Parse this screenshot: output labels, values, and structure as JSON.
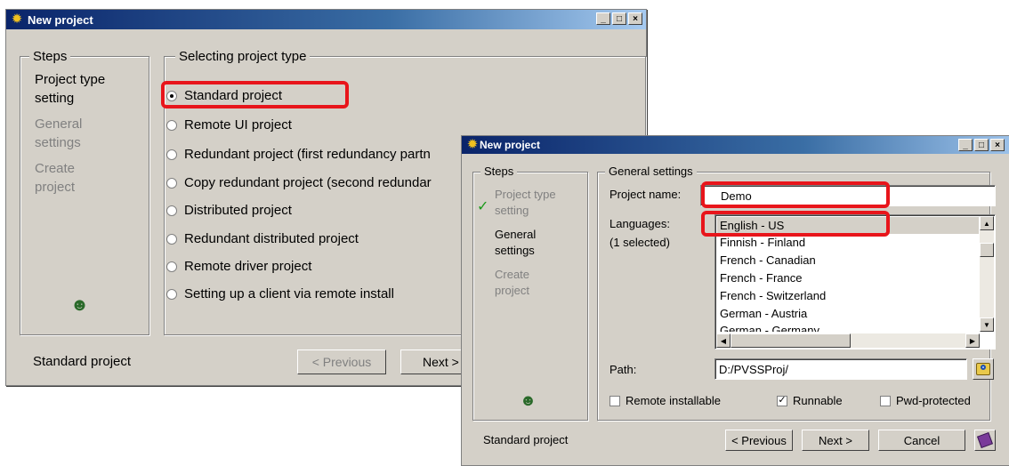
{
  "window1": {
    "title": "New project",
    "steps_label": "Steps",
    "steps": [
      "Project type",
      "setting",
      "General",
      "settings",
      "Create",
      "project"
    ],
    "group_label": "Selecting project type",
    "options": [
      "Standard project",
      "Remote UI project",
      "Redundant project (first redundancy partn",
      "Copy redundant project (second redundar",
      "Distributed project",
      "Redundant distributed project",
      "Remote driver project",
      "Setting up a client via remote install"
    ],
    "status": "Standard project",
    "prev_label": "< Previous",
    "next_label": "Next >"
  },
  "window2": {
    "title": "New project",
    "steps_label": "Steps",
    "steps": [
      "Project type",
      "setting",
      "General",
      "settings",
      "Create",
      "project"
    ],
    "check_mark": "✓",
    "group_label": "General settings",
    "project_name_label": "Project name:",
    "project_name_value": "Demo",
    "languages_label": "Languages:",
    "languages_count": "(1 selected)",
    "languages": [
      "English - US",
      "Finnish - Finland",
      "French - Canadian",
      "French - France",
      "French - Switzerland",
      "German - Austria",
      "German - Germany"
    ],
    "path_label": "Path:",
    "path_value": "D:/PVSSProj/",
    "remote_installable": "Remote installable",
    "runnable": "Runnable",
    "pwd_protected": "Pwd-protected",
    "status": "Standard project",
    "prev_label": "< Previous",
    "next_label": "Next >",
    "cancel_label": "Cancel"
  },
  "title_buttons": {
    "minimize": "_",
    "maximize": "□",
    "close": "×"
  },
  "icons": {
    "app": "gear-icon",
    "people": "people-icon",
    "browse": "folder-search-icon",
    "help": "help-book-icon"
  },
  "colors": {
    "highlight": "#e8151b",
    "face": "#d4d0c8",
    "titlebar": "#0a246a"
  }
}
